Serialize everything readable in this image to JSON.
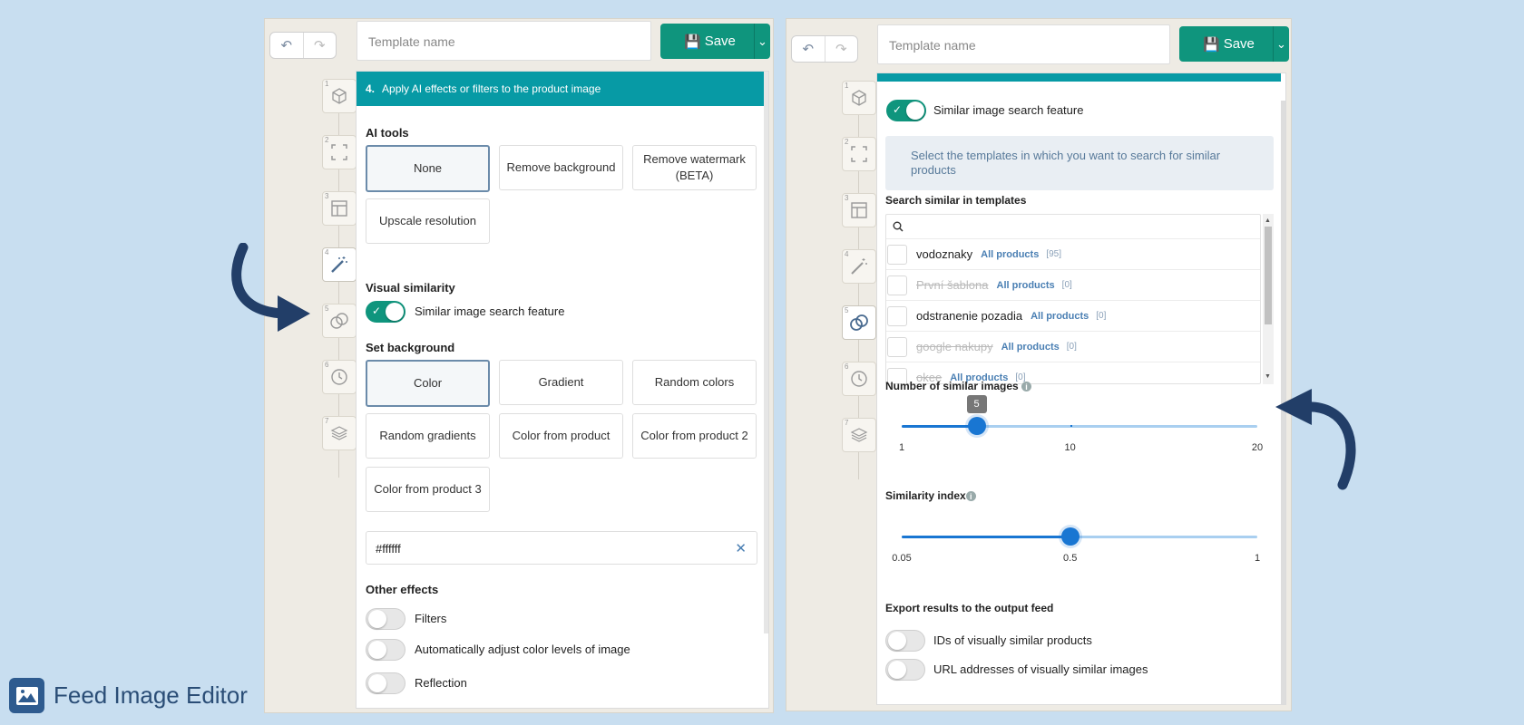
{
  "app": {
    "name": "Feed Image Editor"
  },
  "colors": {
    "accent": "#0f957d",
    "section_header": "#079aa5",
    "arrow": "#223e68",
    "slider": "#1976d2"
  },
  "left": {
    "template_placeholder": "Template name",
    "save_label": "Save",
    "steps": [
      "1",
      "2",
      "3",
      "4",
      "5",
      "6",
      "7"
    ],
    "section": {
      "number": "4.",
      "title": "Apply AI effects or filters to the product image"
    },
    "ai_tools": {
      "label": "AI tools",
      "options": [
        "None",
        "Remove background",
        "Remove watermark (BETA)",
        "Upscale resolution"
      ],
      "selected": "None"
    },
    "visual_similarity": {
      "label": "Visual similarity",
      "toggle_label": "Similar image search feature",
      "on": true
    },
    "background": {
      "label": "Set background",
      "options": [
        "Color",
        "Gradient",
        "Random colors",
        "Random gradients",
        "Color from product",
        "Color from product 2",
        "Color from product 3"
      ],
      "selected": "Color",
      "color_value": "#ffffff",
      "clear_icon": "close-icon"
    },
    "other_effects": {
      "label": "Other effects",
      "items": [
        "Filters",
        "Automatically adjust color levels of image",
        "Reflection"
      ]
    }
  },
  "right": {
    "template_placeholder": "Template name",
    "save_label": "Save",
    "steps": [
      "1",
      "2",
      "3",
      "4",
      "5",
      "6",
      "7"
    ],
    "toggle_label": "Similar image search feature",
    "info": "Select the templates in which you want to search for similar products",
    "search_label": "Search similar in templates",
    "templates": [
      {
        "name": "vodoznaky",
        "tag": "All products",
        "count": "[95]",
        "disabled": false
      },
      {
        "name": "První šablona",
        "tag": "All products",
        "count": "[0]",
        "disabled": true
      },
      {
        "name": "odstranenie pozadia",
        "tag": "All products",
        "count": "[0]",
        "disabled": false
      },
      {
        "name": "google nakupy",
        "tag": "All products",
        "count": "[0]",
        "disabled": true
      },
      {
        "name": "okee",
        "tag": "All products",
        "count": "[0]",
        "disabled": true
      }
    ],
    "num_similar": {
      "label": "Number of similar images",
      "value": 5,
      "tooltip": "5",
      "min_label": "1",
      "mid_label": "10",
      "max_label": "20"
    },
    "similarity_index": {
      "label": "Similarity index",
      "value": 0.5,
      "min_label": "0.05",
      "mid_label": "0.5",
      "max_label": "1"
    },
    "export": {
      "label": "Export results to the output feed",
      "items": [
        "IDs of visually similar products",
        "URL addresses of visually similar images"
      ]
    }
  }
}
